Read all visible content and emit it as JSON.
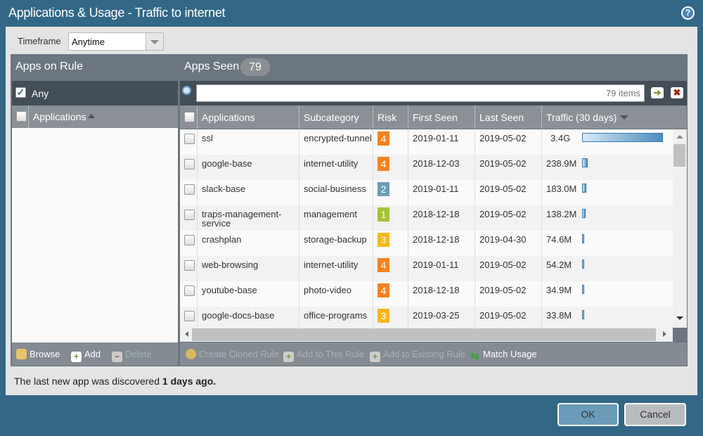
{
  "window": {
    "title": "Applications & Usage - Traffic to internet",
    "help_icon": "?"
  },
  "timeframe": {
    "label": "Timeframe",
    "value": "Anytime"
  },
  "left": {
    "title": "Apps on Rule",
    "any_label": "Any",
    "column": "Applications",
    "browse": "Browse",
    "add": "Add",
    "delete": "Delete"
  },
  "right": {
    "title": "Apps Seen",
    "count": "79",
    "search_placeholder": "79 items",
    "columns": [
      "Applications",
      "Subcategory",
      "Risk",
      "First Seen",
      "Last Seen",
      "Traffic (30 days)"
    ],
    "rows": [
      {
        "app": "ssl",
        "sub": "encrypted-tunnel",
        "risk": "4",
        "first": "2019-01-11",
        "last": "2019-05-02",
        "traffic": "3.4G",
        "traffic_mb": 3400
      },
      {
        "app": "google-base",
        "sub": "internet-utility",
        "risk": "4",
        "first": "2018-12-03",
        "last": "2019-05-02",
        "traffic": "238.9M",
        "traffic_mb": 238.9
      },
      {
        "app": "slack-base",
        "sub": "social-business",
        "risk": "2",
        "first": "2019-01-11",
        "last": "2019-05-02",
        "traffic": "183.0M",
        "traffic_mb": 183.0
      },
      {
        "app": "traps-management-service",
        "sub": "management",
        "risk": "1",
        "first": "2018-12-18",
        "last": "2019-05-02",
        "traffic": "138.2M",
        "traffic_mb": 138.2
      },
      {
        "app": "crashplan",
        "sub": "storage-backup",
        "risk": "3",
        "first": "2018-12-18",
        "last": "2019-04-30",
        "traffic": "74.6M",
        "traffic_mb": 74.6
      },
      {
        "app": "web-browsing",
        "sub": "internet-utility",
        "risk": "4",
        "first": "2019-01-11",
        "last": "2019-05-02",
        "traffic": "54.2M",
        "traffic_mb": 54.2
      },
      {
        "app": "youtube-base",
        "sub": "photo-video",
        "risk": "4",
        "first": "2018-12-18",
        "last": "2019-05-02",
        "traffic": "34.9M",
        "traffic_mb": 34.9
      },
      {
        "app": "google-docs-base",
        "sub": "office-programs",
        "risk": "3",
        "first": "2019-03-25",
        "last": "2019-05-02",
        "traffic": "33.8M",
        "traffic_mb": 33.8
      }
    ],
    "actions": {
      "clone": "Create Cloned Rule",
      "add_this": "Add to This Rule",
      "add_existing": "Add to Existing Rule",
      "match": "Match Usage"
    }
  },
  "risk_colors": {
    "1": "#a4c13a",
    "2": "#6b9bb5",
    "3": "#f7b620",
    "4": "#f58220"
  },
  "status": {
    "prefix": "The last new app was discovered ",
    "bold": "1 days ago."
  },
  "buttons": {
    "ok": "OK",
    "cancel": "Cancel"
  }
}
